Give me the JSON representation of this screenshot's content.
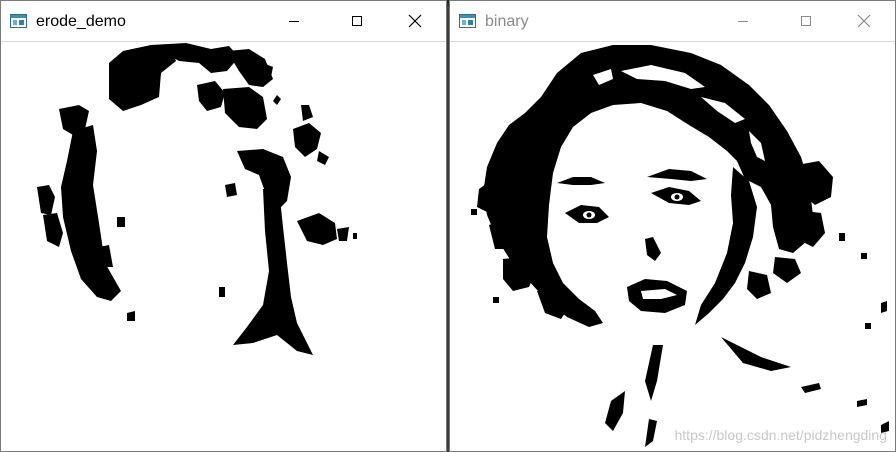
{
  "windows": [
    {
      "title": "erode_demo",
      "icon": "app-window-icon",
      "controls": [
        "minimize-icon",
        "maximize-icon",
        "close-icon"
      ],
      "active": true
    },
    {
      "title": "binary",
      "icon": "app-window-icon",
      "controls": [
        "minimize-icon",
        "maximize-icon",
        "close-icon"
      ],
      "active": false
    }
  ],
  "watermark": "https://blog.csdn.net/pidzhengding",
  "colors": {
    "foreground": "#000000",
    "background": "#ffffff",
    "inactive_title": "#8a8a8a"
  }
}
